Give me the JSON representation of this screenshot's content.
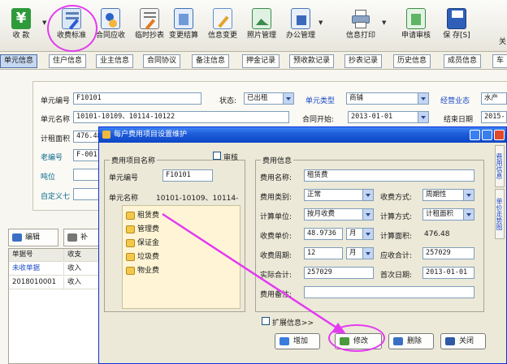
{
  "toolbar": {
    "buttons": [
      {
        "label": "收 款",
        "icon": "yen-icon"
      },
      {
        "label": "收费标准",
        "icon": "edit-pen-icon"
      },
      {
        "label": "合同应收",
        "icon": "contract-receivable-icon"
      },
      {
        "label": "临时抄表",
        "icon": "meter-reading-icon"
      },
      {
        "label": "变更结算",
        "icon": "settlement-change-icon"
      },
      {
        "label": "信息变更",
        "icon": "info-change-icon"
      },
      {
        "label": "照片管理",
        "icon": "photo-icon"
      },
      {
        "label": "办公管理",
        "icon": "office-icon"
      },
      {
        "label": "信息打印",
        "icon": "printer-icon"
      },
      {
        "label": "申请审核",
        "icon": "approval-icon"
      },
      {
        "label": "保 存[S]",
        "icon": "save-icon"
      }
    ]
  },
  "tabs": [
    "单元信息",
    "住户信息",
    "业主信息",
    "合同协议",
    "备注信息",
    "押金记录",
    "预收款记录",
    "抄表记录",
    "历史信息",
    "成员信息",
    "车"
  ],
  "unit_form": {
    "unit_no_label": "单元编号",
    "unit_no": "F10101",
    "status_label": "状态:",
    "status": "已出租",
    "unit_type_label": "单元类型",
    "unit_type": "商铺",
    "business_label": "经营业态",
    "business": "水产",
    "unit_name_label": "单元名称",
    "unit_name": "10101-10109、10114-10122",
    "contract_start_label": "合同开始:",
    "contract_start": "2013-01-01",
    "end_date_label": "结束日期",
    "end_date": "2015-",
    "area_label": "计租面积",
    "area": "476.48",
    "old_no_label": "老编号",
    "old_no": "F-001",
    "booth_label": "吨位",
    "custom7_label": "自定义七"
  },
  "list": {
    "edit_button": "编辑",
    "supplement_button": "补",
    "columns": [
      "单据号",
      "收支"
    ],
    "rows": [
      {
        "no": "未收单据",
        "type": "收入"
      },
      {
        "no": "2018010001",
        "type": "收入"
      }
    ]
  },
  "dialog": {
    "title": "每户费用项目设置维护",
    "left_group_title": "费用项目名称",
    "audit_label": "审核",
    "unit_no_label": "单元编号",
    "unit_no": "F10101",
    "unit_name_label": "单元名称",
    "unit_name": "10101-10109、10114-",
    "items": [
      "租赁费",
      "管理费",
      "保证金",
      "垃圾费",
      "物业费"
    ],
    "right_group_title": "费用信息",
    "fee_name_label": "费用名称:",
    "fee_name": "租赁费",
    "fee_category_label": "费用类别:",
    "fee_category": "正常",
    "charge_mode_label": "收费方式:",
    "charge_mode": "周期性",
    "calc_unit_label": "计算单位:",
    "calc_unit": "按月收费",
    "calc_method_label": "计算方式:",
    "calc_method": "计租面积",
    "unit_price_label": "收费单价:",
    "unit_price": "48.9736",
    "unit_price_unit": "月",
    "calc_area_label": "计算面积:",
    "calc_area": "476.48",
    "cycle_label": "收费周期:",
    "cycle": "12",
    "cycle_unit": "月",
    "receivable_label": "应收合计:",
    "receivable": "257029",
    "actual_label": "实际合计:",
    "actual": "257029",
    "first_date_label": "首次日期:",
    "first_date": "2013-01-01",
    "note_label": "费用备注:",
    "extend_label": "扩展信息>>",
    "side_tabs": [
      "费用信息",
      "单价走势图"
    ],
    "buttons": {
      "add": "增加",
      "modify": "修改",
      "delete": "删除",
      "close": "关闭"
    }
  },
  "colors": {
    "accent": "#0c46c6",
    "annotation": "#e33af0",
    "tree_bg": "#fff5d6"
  }
}
